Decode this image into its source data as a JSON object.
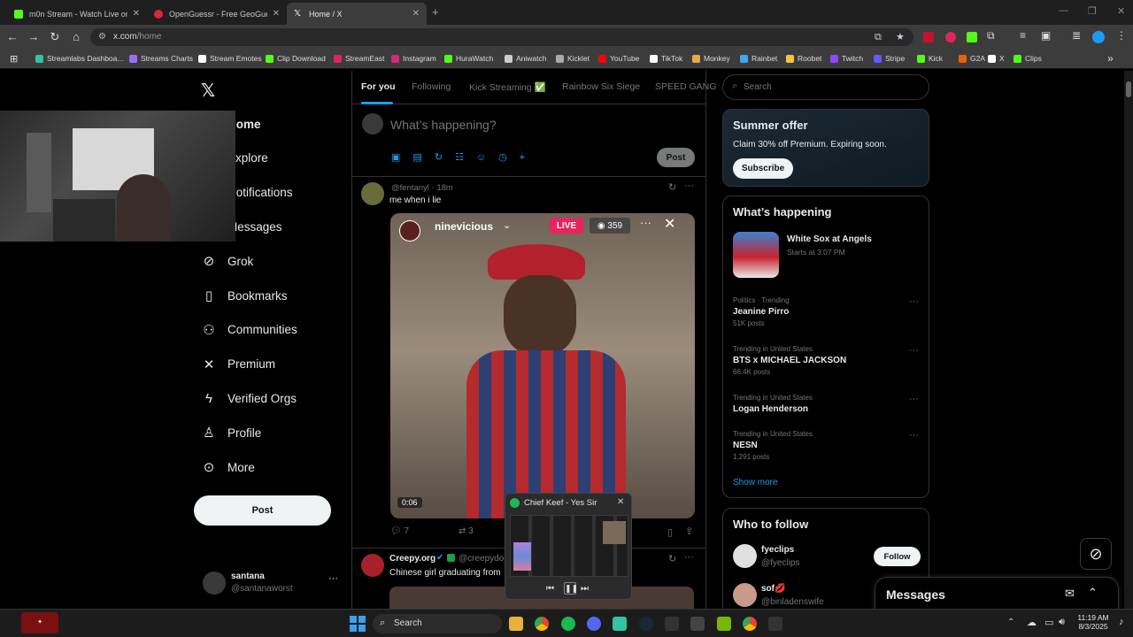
{
  "browser": {
    "tabs": [
      {
        "title": "m0n Stream - Watch Live on Kick",
        "color": "#53fc18",
        "active": false
      },
      {
        "title": "OpenGuessr - Free GeoGuessr",
        "color": "#e0243c",
        "active": false
      },
      {
        "title": "Home / X",
        "color": "#ffffff",
        "active": true
      }
    ],
    "new_tab_label": "+",
    "url_host": "x.com",
    "url_path": "/home",
    "bookmarks": [
      {
        "label": "Streamlabs Dashboa...",
        "color": "#31c3a2"
      },
      {
        "label": "Streams Charts",
        "color": "#9b6cff"
      },
      {
        "label": "Stream Emotes",
        "color": "#ffffff"
      },
      {
        "label": "Clip Download",
        "color": "#53fc18"
      },
      {
        "label": "StreamEast",
        "color": "#e0245e"
      },
      {
        "label": "Instagram",
        "color": "#d62976"
      },
      {
        "label": "HuraWatch",
        "color": "#53fc18"
      },
      {
        "label": "Aniwatch",
        "color": "#cccccc"
      },
      {
        "label": "Kicklet",
        "color": "#aaaaaa"
      },
      {
        "label": "YouTube",
        "color": "#ff0000"
      },
      {
        "label": "TikTok",
        "color": "#ffffff"
      },
      {
        "label": "Monkey",
        "color": "#e8a84c"
      },
      {
        "label": "Rainbet",
        "color": "#3fa9f5"
      },
      {
        "label": "Roobet",
        "color": "#f5c542"
      },
      {
        "label": "Twitch",
        "color": "#9146ff"
      },
      {
        "label": "Stripe",
        "color": "#635bff"
      },
      {
        "label": "Kick",
        "color": "#53fc18"
      },
      {
        "label": "G2A",
        "color": "#f05f00"
      },
      {
        "label": "X",
        "color": "#ffffff"
      },
      {
        "label": "Clips",
        "color": "#53fc18"
      }
    ]
  },
  "x": {
    "nav": [
      {
        "label": "Home",
        "icon": "home-icon",
        "glyph": "⌂"
      },
      {
        "label": "Explore",
        "icon": "search-icon",
        "glyph": "⌕"
      },
      {
        "label": "Notifications",
        "icon": "bell-icon",
        "glyph": "♫"
      },
      {
        "label": "Messages",
        "icon": "mail-icon",
        "glyph": "✉"
      },
      {
        "label": "Grok",
        "icon": "grok-icon",
        "glyph": "⊘"
      },
      {
        "label": "Bookmarks",
        "icon": "bookmark-icon",
        "glyph": "▯"
      },
      {
        "label": "Communities",
        "icon": "communities-icon",
        "glyph": "⚇"
      },
      {
        "label": "Premium",
        "icon": "premium-icon",
        "glyph": "✕"
      },
      {
        "label": "Verified Orgs",
        "icon": "lightning-icon",
        "glyph": "ϟ"
      },
      {
        "label": "Profile",
        "icon": "profile-icon",
        "glyph": "♙"
      },
      {
        "label": "More",
        "icon": "more-icon",
        "glyph": "⊙"
      }
    ],
    "post_button": "Post",
    "account": {
      "name": "santana",
      "handle": "@santanaworst"
    },
    "feed_tabs": [
      "For you",
      "Following",
      "Kick Streaming ✅",
      "Rainbow Six Siege",
      "SPEED GANG"
    ],
    "compose_placeholder": "What’s happening?",
    "compose_post": "Post",
    "post1": {
      "handle": "@fentanyl",
      "time": "· 18m",
      "text": "me when i lie",
      "video": {
        "user": "ninevicious",
        "live": "LIVE",
        "viewers": "359",
        "timecode": "0:06"
      },
      "replies": "7",
      "reposts": "3"
    },
    "post2": {
      "name": "Creepy.org",
      "handle": "@creepydo",
      "text": "Chinese girl graduating from"
    },
    "search_placeholder": "Search",
    "summer": {
      "title": "Summer offer",
      "text": "Claim 30% off Premium. Expiring soon.",
      "button": "Subscribe"
    },
    "happening": {
      "title": "What’s happening",
      "event": {
        "title": "White Sox at Angels",
        "meta": "Starts at 3:07 PM"
      },
      "trends": [
        {
          "meta": "Politics · Trending",
          "title": "Jeanine Pirro",
          "count": "51K posts"
        },
        {
          "meta": "Trending in United States",
          "title": "BTS x MICHAEL JACKSON",
          "count": "66.4K posts"
        },
        {
          "meta": "Trending in United States",
          "title": "Logan Henderson",
          "count": ""
        },
        {
          "meta": "Trending in United States",
          "title": "NESN",
          "count": "1,291 posts"
        }
      ],
      "show_more": "Show more"
    },
    "who_to_follow": {
      "title": "Who to follow",
      "users": [
        {
          "name": "fyeclips",
          "handle": "@fyeclips",
          "button": "Follow"
        },
        {
          "name": "sof💋",
          "handle": "@binladenswife"
        }
      ]
    },
    "messages_drawer": "Messages"
  },
  "media_popup": {
    "title": "Chief Keef - Yes Sir"
  },
  "taskbar": {
    "search": "Search",
    "time": "11:19 AM",
    "date": "8/3/2025"
  }
}
